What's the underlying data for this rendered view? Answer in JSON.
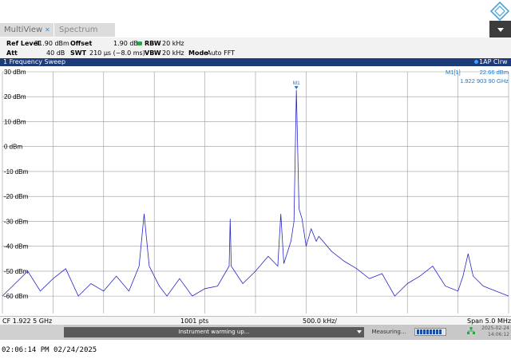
{
  "tabs": [
    {
      "label": "MultiView"
    },
    {
      "label": "Spectrum"
    }
  ],
  "params": {
    "ref_level_label": "Ref Level",
    "ref_level_value": "31.90 dBm",
    "offset_label": "Offset",
    "offset_value": "1.90 dB",
    "rbw_label": "RBW",
    "rbw_value": "20 kHz",
    "att_label": "Att",
    "att_value": "40 dB",
    "swt_label": "SWT",
    "swt_value": "210 µs (~8.0 ms)",
    "vbw_label": "VBW",
    "vbw_value": "20 kHz",
    "mode_label": "Mode",
    "mode_value": "Auto FFT"
  },
  "sweep": {
    "title": "1 Frequency Sweep",
    "trace_label": "1AP Clrw",
    "marker_label": "M1[1]",
    "marker_level": "22.66 dBm",
    "marker_freq": "1.922 903 90 GHz",
    "marker_tag": "M1"
  },
  "axis": {
    "center": "CF 1.922 5 GHz",
    "points": "1001 pts",
    "per_div": "500.0 kHz/",
    "span": "Span 5.0 MHz"
  },
  "status": {
    "warming": "Instrument warming up...",
    "measuring": "Measuring...",
    "date": "2025-02-24",
    "time": "14:06:12",
    "progress_fraction": 0.85
  },
  "timestamp": "02:06:14 PM  02/24/2025",
  "colors": {
    "trace": "#2727c8",
    "marker": "#1e78c8",
    "header_bar": "#1d3b78",
    "grid": "#9a9a9a"
  },
  "chart_data": {
    "type": "line",
    "title": "1 Frequency Sweep",
    "y_tick_labels": [
      "30 dBm",
      "20 dBm",
      "10 dBm",
      "0 dBm",
      "-10 dBm",
      "-20 dBm",
      "-30 dBm",
      "-40 dBm",
      "-50 dBm",
      "-60 dBm"
    ],
    "ylim": [
      -67,
      30
    ],
    "xlim": [
      1920000000,
      1925000000
    ],
    "grid": true,
    "series": [
      {
        "name": "1AP Clrw",
        "x": [
          1920000000,
          1920125000,
          1920250000,
          1920375000,
          1920500000,
          1920625000,
          1920750000,
          1920875000,
          1921000000,
          1921125000,
          1921250000,
          1921350000,
          1921400000,
          1921450000,
          1921550000,
          1921625000,
          1921750000,
          1921875000,
          1922000000,
          1922125000,
          1922240000,
          1922250000,
          1922260000,
          1922375000,
          1922500000,
          1922625000,
          1922720000,
          1922750000,
          1922780000,
          1922850000,
          1922880000,
          1922904000,
          1922930000,
          1922960000,
          1923000000,
          1923050000,
          1923100000,
          1923125000,
          1923250000,
          1923375000,
          1923500000,
          1923625000,
          1923750000,
          1923875000,
          1924000000,
          1924125000,
          1924250000,
          1924375000,
          1924500000,
          1924550000,
          1924600000,
          1924650000,
          1924750000,
          1924875000,
          1925000000
        ],
        "values": [
          -60,
          -55,
          -50,
          -58,
          -53,
          -49,
          -60,
          -55,
          -58,
          -52,
          -58,
          -48,
          -27,
          -48,
          -56,
          -60,
          -53,
          -60,
          -57,
          -56,
          -48,
          -29,
          -48,
          -55,
          -50,
          -44,
          -48,
          -27,
          -47,
          -38,
          -30,
          22.7,
          -25,
          -29,
          -40,
          -33,
          -38,
          -36,
          -42,
          -46,
          -49,
          -53,
          -51,
          -60,
          -55,
          -52,
          -48,
          -56,
          -58,
          -52,
          -43,
          -52,
          -56,
          -58,
          -60
        ]
      }
    ],
    "marker": {
      "name": "M1",
      "x": 1922903900,
      "y": 22.66
    }
  }
}
